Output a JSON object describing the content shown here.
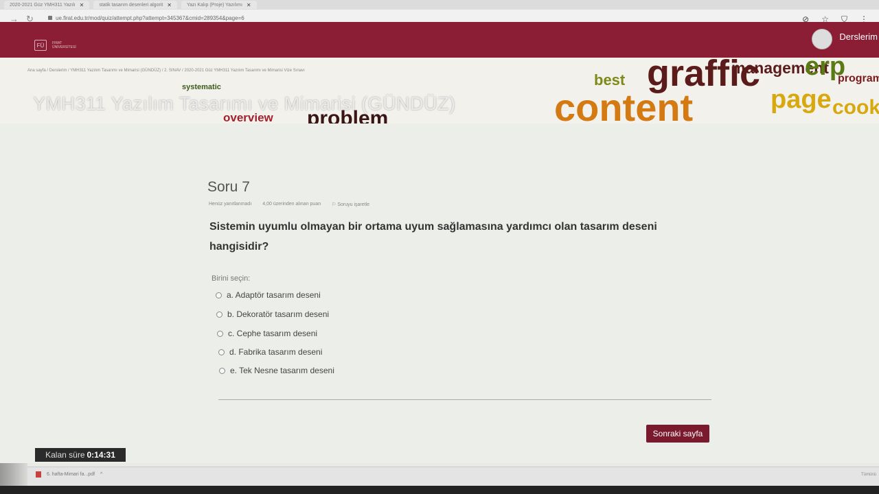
{
  "browser": {
    "tabs": [
      {
        "label": "2020-2021 Güz YMH311 Yazılı"
      },
      {
        "label": "statik tasarım desenleri algorit"
      },
      {
        "label": "Yazı Kalıp (Proje) Yazılımı"
      }
    ],
    "url": "ue.firat.edu.tr/mod/quiz/attempt.php?attempt=345367&cmid=289354&page=6"
  },
  "header": {
    "logo_line1": "FIRAT",
    "logo_line2": "ÜNİVERSİTESİ",
    "user_menu_label": "Derslerim"
  },
  "banner": {
    "breadcrumb": "Ana sayfa  /  Derslerim  /  YMH311 Yazılım Tasarımı ve Mimarisi (GÜNDÜZ)  /  2. SINAV  /  2020-2021 Güz YMH311 Yazılım Tasarımı ve Mimarisi Vize Sınavı",
    "course_title": "YMH311 Yazılım Tasarımı ve Mimarisi (GÜNDÜZ)",
    "words": [
      "systematic",
      "overview",
      "problem",
      "best",
      "graffic",
      "management",
      "erp",
      "programming",
      "content",
      "page",
      "cook"
    ]
  },
  "question": {
    "number_label": "Soru 7",
    "status": "Henüz yanıtlanmadı",
    "points": "4,00 üzerinden alınan puan",
    "flag_label": "Soruyu işaretle",
    "text": "Sistemin uyumlu olmayan bir ortama uyum sağlamasına yardımcı olan tasarım deseni hangisidir?",
    "prompt": "Birini seçin:",
    "options": [
      "a. Adaptör tasarım deseni",
      "b. Dekoratör tasarım deseni",
      "c. Cephe tasarım deseni",
      "d. Fabrika tasarım deseni",
      "e. Tek Nesne tasarım deseni"
    ]
  },
  "actions": {
    "next_label": "Sonraki sayfa"
  },
  "timer": {
    "label": "Kalan süre",
    "value": "0:14:31"
  },
  "downloads": {
    "file": "6. hafta-Mimari fa...pdf",
    "show_all": "Tümünü"
  }
}
